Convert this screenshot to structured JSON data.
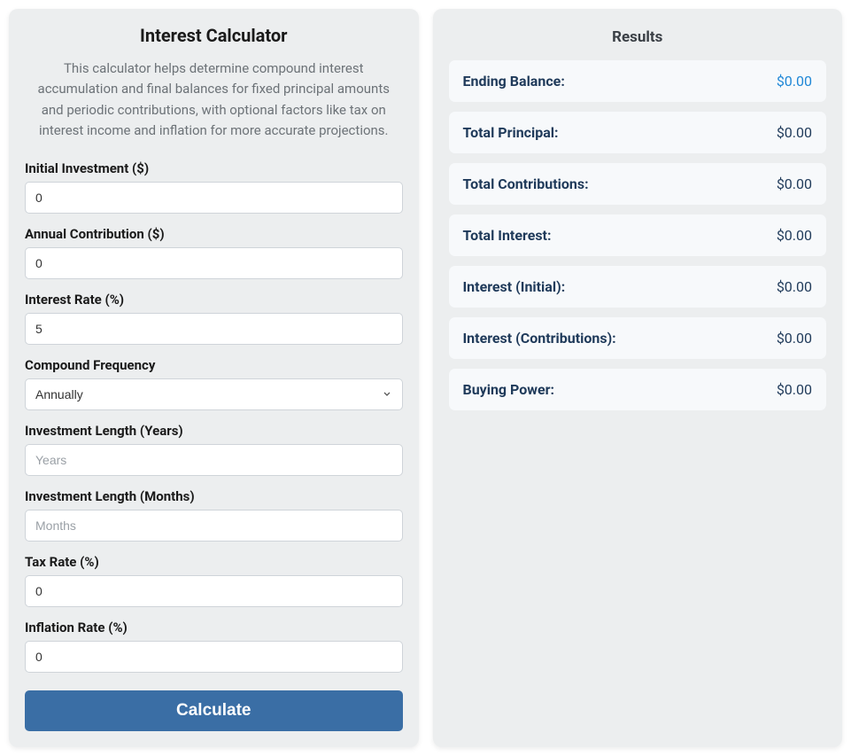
{
  "calculator": {
    "title": "Interest Calculator",
    "description": "This calculator helps determine compound interest accumulation and final balances for fixed principal amounts and periodic contributions, with optional factors like tax on interest income and inflation for more accurate projections.",
    "fields": {
      "initial_investment": {
        "label": "Initial Investment ($)",
        "value": "0"
      },
      "annual_contribution": {
        "label": "Annual Contribution ($)",
        "value": "0"
      },
      "interest_rate": {
        "label": "Interest Rate (%)",
        "value": "5"
      },
      "compound_frequency": {
        "label": "Compound Frequency",
        "selected": "Annually"
      },
      "length_years": {
        "label": "Investment Length (Years)",
        "placeholder": "Years",
        "value": ""
      },
      "length_months": {
        "label": "Investment Length (Months)",
        "placeholder": "Months",
        "value": ""
      },
      "tax_rate": {
        "label": "Tax Rate (%)",
        "value": "0"
      },
      "inflation_rate": {
        "label": "Inflation Rate (%)",
        "value": "0"
      }
    },
    "button": "Calculate"
  },
  "results": {
    "title": "Results",
    "rows": [
      {
        "label": "Ending Balance:",
        "value": "$0.00",
        "highlight": true
      },
      {
        "label": "Total Principal:",
        "value": "$0.00",
        "highlight": false
      },
      {
        "label": "Total Contributions:",
        "value": "$0.00",
        "highlight": false
      },
      {
        "label": "Total Interest:",
        "value": "$0.00",
        "highlight": false
      },
      {
        "label": "Interest (Initial):",
        "value": "$0.00",
        "highlight": false
      },
      {
        "label": "Interest (Contributions):",
        "value": "$0.00",
        "highlight": false
      },
      {
        "label": "Buying Power:",
        "value": "$0.00",
        "highlight": false
      }
    ]
  }
}
